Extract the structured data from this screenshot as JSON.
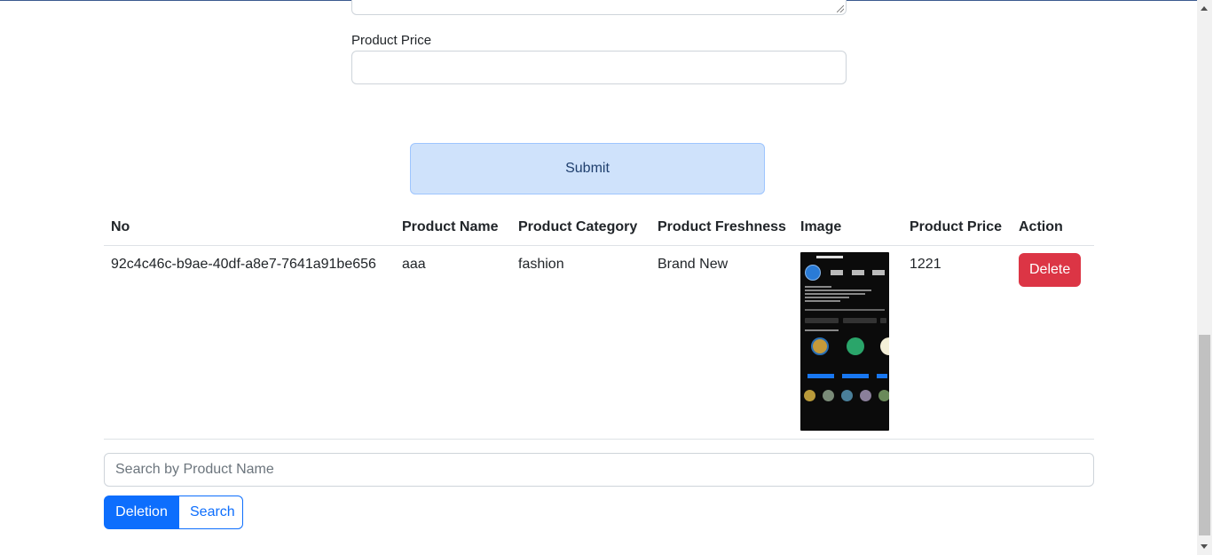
{
  "form": {
    "price_label": "Product Price",
    "price_value": "",
    "submit_label": "Submit"
  },
  "table": {
    "headers": [
      "No",
      "Product Name",
      "Product Category",
      "Product Freshness",
      "Image",
      "Product Price",
      "Action"
    ],
    "rows": [
      {
        "no": "92c4c46c-b9ae-40df-a8e7-7641a91be656",
        "name": "aaa",
        "category": "fashion",
        "freshness": "Brand New",
        "price": "1221",
        "action_label": "Delete"
      }
    ]
  },
  "search": {
    "placeholder": "Search by Product Name",
    "value": ""
  },
  "mode_buttons": {
    "deletion_label": "Deletion",
    "search_label": "Search",
    "active": "Deletion"
  },
  "colors": {
    "primary": "#0d6efd",
    "danger": "#dc3545",
    "submit_bg": "#cfe2fb"
  }
}
